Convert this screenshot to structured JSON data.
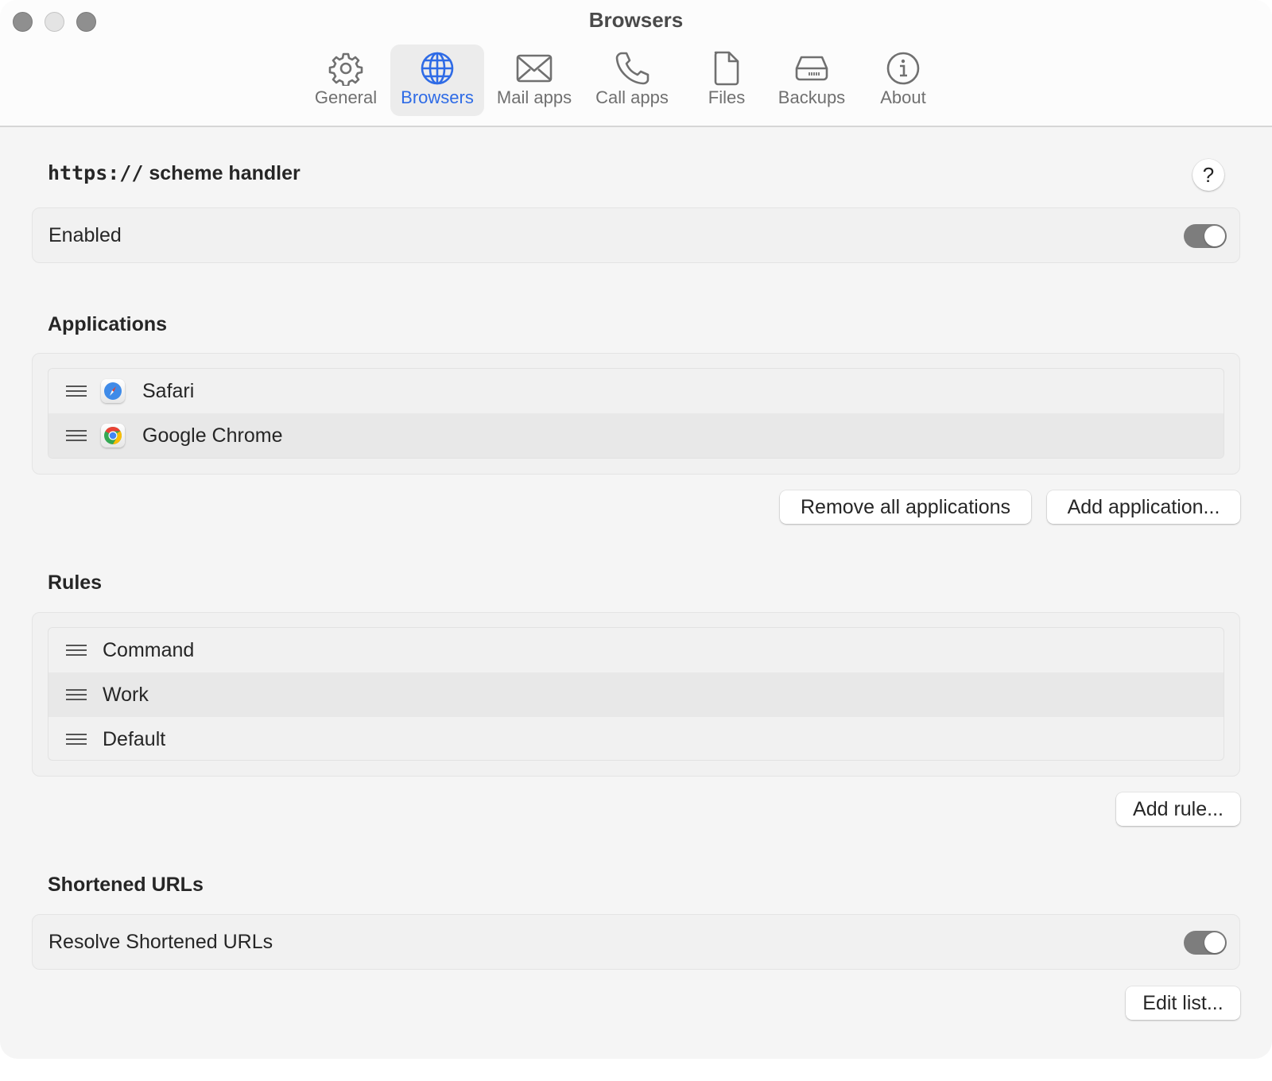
{
  "window": {
    "title": "Browsers",
    "traffic_lights": [
      "close",
      "minimize",
      "zoom"
    ]
  },
  "tabs": [
    {
      "label": "General",
      "icon": "gear-icon",
      "active": false
    },
    {
      "label": "Browsers",
      "icon": "globe-icon",
      "active": true
    },
    {
      "label": "Mail apps",
      "icon": "envelope-icon",
      "active": false
    },
    {
      "label": "Call apps",
      "icon": "phone-icon",
      "active": false
    },
    {
      "label": "Files",
      "icon": "document-icon",
      "active": false
    },
    {
      "label": "Backups",
      "icon": "drive-icon",
      "active": false
    },
    {
      "label": "About",
      "icon": "info-icon",
      "active": false
    }
  ],
  "colors": {
    "accent": "#2e6be6",
    "toggle_on": "#7d7d7d"
  },
  "scheme": {
    "title_code": "https://",
    "title_text": " scheme handler",
    "help_label": "?",
    "enabled_label": "Enabled",
    "enabled": true
  },
  "applications": {
    "title": "Applications",
    "items": [
      {
        "name": "Safari",
        "icon": "safari-icon"
      },
      {
        "name": "Google Chrome",
        "icon": "chrome-icon"
      }
    ],
    "remove_all_label": "Remove all applications",
    "add_label": "Add application..."
  },
  "rules": {
    "title": "Rules",
    "items": [
      {
        "name": "Command"
      },
      {
        "name": "Work"
      },
      {
        "name": "Default"
      }
    ],
    "add_label": "Add rule..."
  },
  "shortened": {
    "title": "Shortened URLs",
    "resolve_label": "Resolve Shortened URLs",
    "resolve_enabled": true,
    "edit_label": "Edit list..."
  }
}
